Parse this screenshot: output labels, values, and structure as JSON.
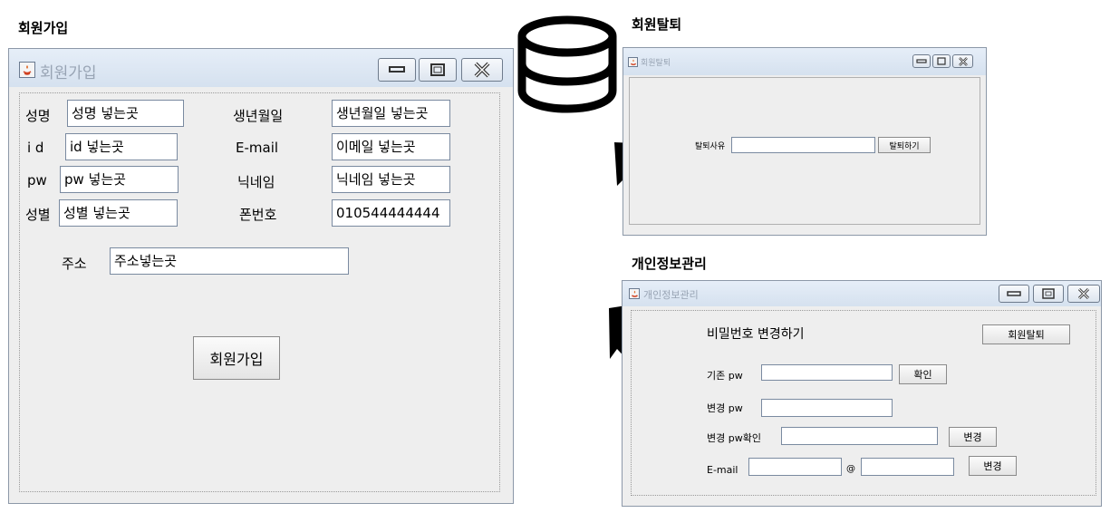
{
  "diagram": {
    "signup_heading": "회원가입",
    "withdraw_heading": "회원탈퇴",
    "privacy_heading": "개인정보관리"
  },
  "signup_window": {
    "title": "회원가입",
    "name_label": "성명",
    "name_value": "성명 넣는곳",
    "birth_label": "생년월일",
    "birth_value": "생년월일 넣는곳",
    "id_label": "i d",
    "id_value": "id 넣는곳",
    "email_label": "E-mail",
    "email_value": "이메일 넣는곳",
    "pw_label": "pw",
    "pw_value": "pw 넣는곳",
    "nickname_label": "닉네임",
    "nickname_value": "닉네임 넣는곳",
    "gender_label": "성별",
    "gender_value": "성별 넣는곳",
    "phone_label": "폰번호",
    "phone_value": "010544444444",
    "address_label": "주소",
    "address_value": "주소넣는곳",
    "signup_button": "회원가입"
  },
  "withdraw_window": {
    "title": "회원탈퇴",
    "reason_label": "탈퇴사유",
    "reason_value": "",
    "withdraw_button": "탈퇴하기"
  },
  "privacy_window": {
    "title": "개인정보관리",
    "change_password_heading": "비밀번호 변경하기",
    "withdraw_button": "회원탈퇴",
    "current_pw_label": "기존 pw",
    "current_pw_value": "",
    "confirm_button": "확인",
    "new_pw_label": "변경 pw",
    "new_pw_value": "",
    "new_pw_confirm_label": "변경 pw확인",
    "new_pw_confirm_value": "",
    "change_pw_button": "변경",
    "email_label": "E-mail",
    "email_local_value": "",
    "email_at": "@",
    "email_domain_value": "",
    "change_email_button": "변경"
  },
  "icons": {
    "database": "database-icon",
    "arrow": "arrow-icon",
    "app": "java-app-icon"
  },
  "colors": {
    "arrow": "#000000",
    "title_bar": "#dce6f2",
    "window_bg": "#eeeeee"
  }
}
